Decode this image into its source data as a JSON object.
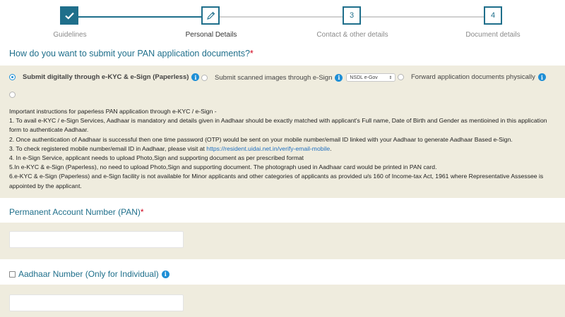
{
  "stepper": {
    "steps": [
      {
        "number": "",
        "label": "Guidelines",
        "state": "complete",
        "icon": "check-icon"
      },
      {
        "number": "",
        "label": "Personal Details",
        "state": "active",
        "icon": "pencil-icon"
      },
      {
        "number": "3",
        "label": "Contact & other details",
        "state": "todo"
      },
      {
        "number": "4",
        "label": "Document details",
        "state": "todo"
      }
    ]
  },
  "question": {
    "text": "How do you want to submit your PAN application documents?",
    "required_mark": "*"
  },
  "options": {
    "ekyc": {
      "label": "Submit digitally through e-KYC & e-Sign (Paperless)",
      "selected": true
    },
    "scanned": {
      "label": "Submit scanned images through e-Sign",
      "selected": false,
      "select_value": "NSDL e-Gov"
    },
    "physical": {
      "label": "Forward application documents physically",
      "selected": false
    }
  },
  "instructions": {
    "heading": "Important instructions for paperless PAN application through e-KYC / e-Sign -",
    "items": [
      "1. To avail e-KYC / e-Sign Services, Aadhaar is mandatory and details given in Aadhaar should be exactly matched with applicant's Full name, Date of Birth and Gender as mentioined in this application form to authenticate Aadhaar.",
      "2. Once authentication of Aadhaar is successful then one time password (OTP) would be sent on your mobile number/email ID linked with your Aadhaar to generate Aadhaar Based e-Sign.",
      "3. To check registered mobile number/email ID in Aadhaar, please visit at ",
      "4. In e-Sign Service, applicant needs to upload Photo,Sign and supporting document as per prescribed format",
      "5.In e-KYC & e-Sign (Paperless), no need to upload Photo,Sign and supporting document. The photograph used in Aadhaar card would be printed in PAN card.",
      "6.e-KYC & e-Sign (Paperless) and e-Sign facility is not available for Minor applicants and other categories of applicants as provided u/s 160 of Income-tax Act, 1961 where Representative Assessee is appointed by the applicant."
    ],
    "link": "https://resident.uidai.net.in/verify-email-mobile",
    "link_suffix": "."
  },
  "pan": {
    "label": "Permanent Account Number (PAN)",
    "required_mark": "*",
    "value": ""
  },
  "aadhaar": {
    "label": "Aadhaar Number (Only for Individual)",
    "checked": false,
    "value": ""
  },
  "colors": {
    "accent": "#1f6f8b",
    "panel": "#efecde",
    "link": "#1f6fc0",
    "required": "#d0021b"
  }
}
